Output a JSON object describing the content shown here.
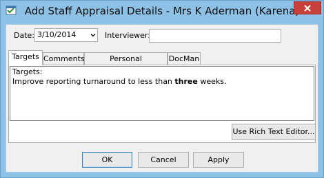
{
  "window": {
    "title": "Add Staff Appraisal Details - Mrs K Aderman (Karena)"
  },
  "form": {
    "date_label": "Date:",
    "date_value": "3/10/2014",
    "interviewer_label": "Interviewer:",
    "interviewer_value": ""
  },
  "tabs": [
    {
      "label": "Targets",
      "active": true
    },
    {
      "label": "Comments",
      "active": false
    },
    {
      "label": "Personal Development",
      "active": false
    },
    {
      "label": "DocMan",
      "active": false
    }
  ],
  "editor": {
    "line1": "Targets:",
    "line2_prefix": "Improve reporting turnaround to less than ",
    "line2_bold": "three",
    "line2_suffix": " weeks."
  },
  "buttons": {
    "rich_text": "Use Rich Text Editor...",
    "ok": "OK",
    "cancel": "Cancel",
    "apply": "Apply"
  },
  "icons": {
    "app": "app-icon",
    "close": "close-icon",
    "dropdown": "chevron-down-icon"
  },
  "colors": {
    "titlebar": "#8ec1e6",
    "close": "#c7403a",
    "client": "#f0f0f0"
  }
}
